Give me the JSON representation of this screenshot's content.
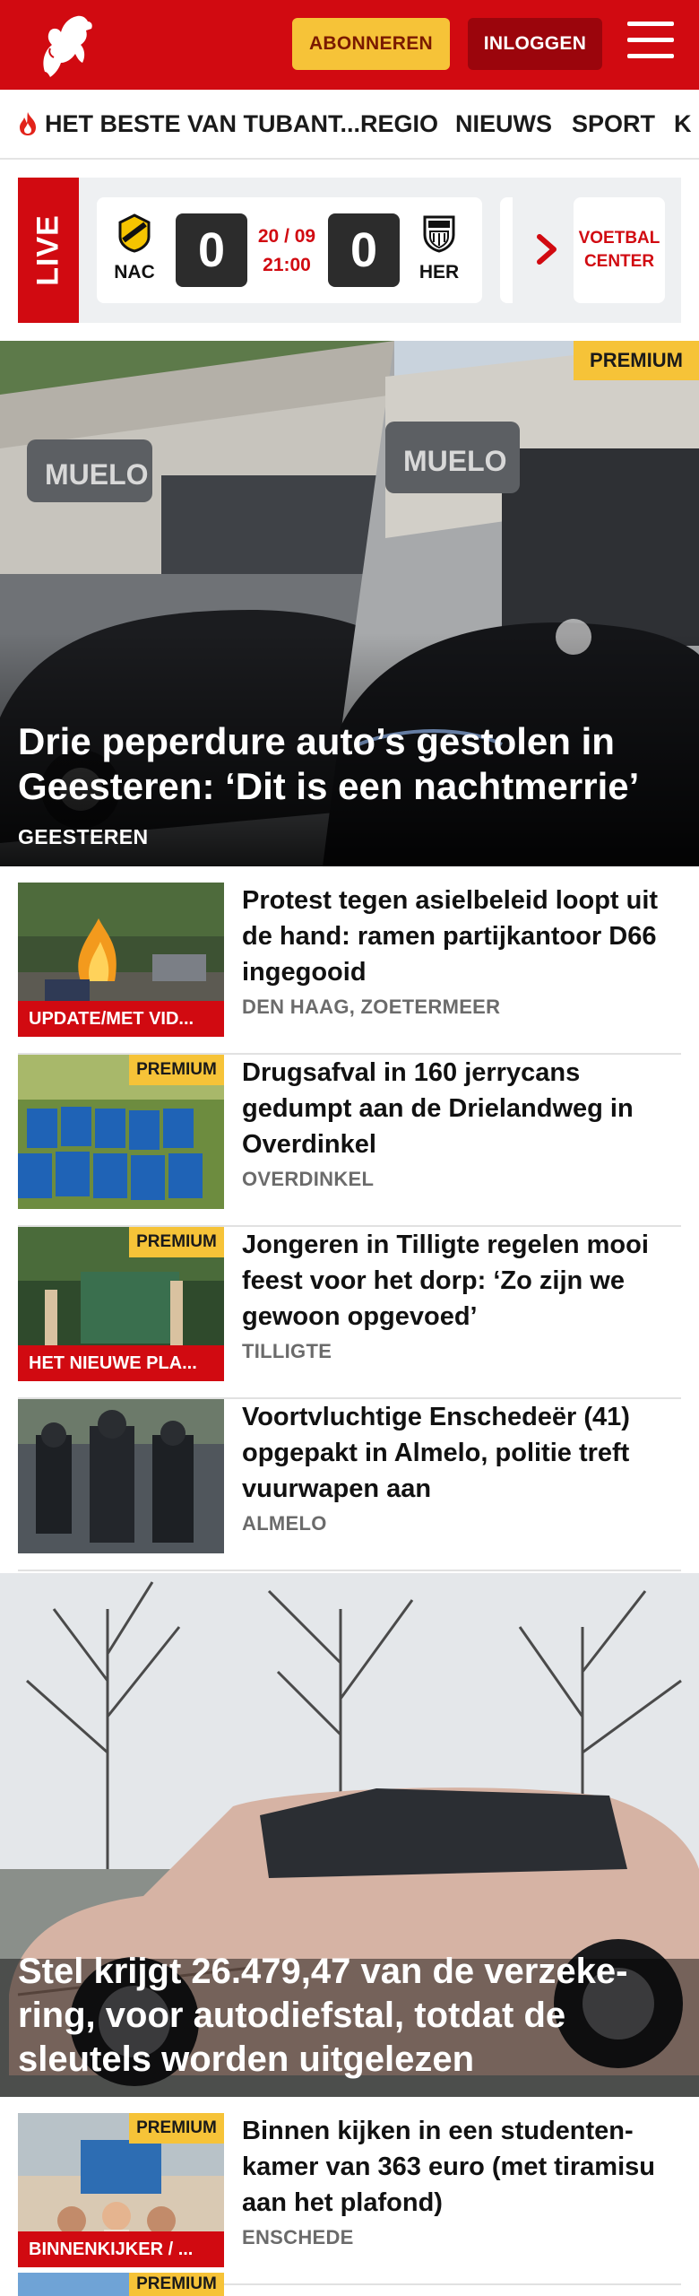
{
  "header": {
    "subscribe_label": "ABONNEREN",
    "login_label": "INLOGGEN"
  },
  "nav": {
    "items": [
      "HET BESTE VAN TUBANT...",
      "REGIO",
      "NIEUWS",
      "SPORT",
      "K"
    ]
  },
  "live": {
    "label": "LIVE",
    "home_team": "NAC",
    "away_team": "HER",
    "home_score": "0",
    "away_score": "0",
    "date": "20 / 09",
    "time": "21:00",
    "voetbal_center": "VOETBAL CENTER"
  },
  "hero": {
    "badge": "PREMIUM",
    "title": "Drie peperdure auto’s gestolen in Geesteren: ‘Dit is een nachtmerrie’",
    "location": "GEESTEREN"
  },
  "articles": [
    {
      "title": "Protest tegen asielbeleid loopt uit de hand: ramen partijkantoor D66 ingegooid",
      "location": "DEN HAAG, ZOETERMEER",
      "caption": "UPDATE/MET VID...",
      "premium": ""
    },
    {
      "title": "Drugsafval in 160 jerrycans gedumpt aan de Drielandweg in Overdinkel",
      "location": "OVERDINKEL",
      "caption": "",
      "premium": "PREMIUM"
    },
    {
      "title": "Jongeren in Tilligte regelen mooi feest voor het dorp: ‘Zo zijn we gewoon opgevoed’",
      "location": "TILLIGTE",
      "caption": "HET NIEUWE PLA...",
      "premium": "PREMIUM"
    },
    {
      "title": "Voortvluchtige Enschedeër (41) opgepakt in Almelo, politie treft vuurwapen aan",
      "location": "ALMELO",
      "caption": "",
      "premium": ""
    }
  ],
  "hero2": {
    "title": "Stel krijgt 26.479,47 van de verzeke­ring, voor autodiefstal, totdat de sleutels worden uitgelezen"
  },
  "article5": {
    "title": "Binnen kijken in een studenten­kamer van 363 euro (met tiramisu aan het plafond)",
    "location": "ENSCHEDE",
    "caption": "BINNENKIJKER / ...",
    "premium": "PREMIUM"
  },
  "article6": {
    "premium": "PREMIUM"
  },
  "colors": {
    "brand_red": "#d10a11",
    "premium_yellow": "#f6c338",
    "login_dark_red": "#9b050c"
  },
  "icons": [
    "tubantia-horse-logo",
    "hamburger-menu-icon",
    "flame-icon",
    "nac-crest-icon",
    "heracles-crest-icon",
    "chevron-right-icon"
  ]
}
